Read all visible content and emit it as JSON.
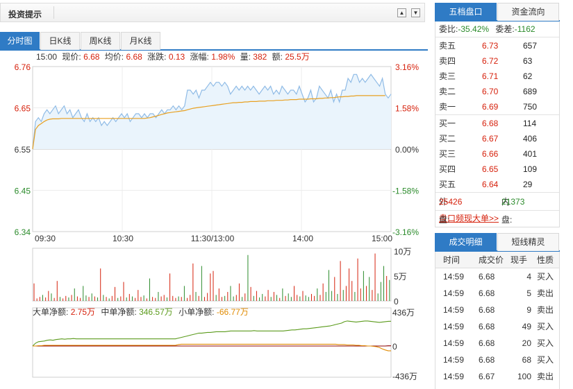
{
  "header": {
    "title": "投资提示",
    "up_icon": "▲",
    "down_icon": "▼"
  },
  "tabs": [
    "分时图",
    "日K线",
    "周K线",
    "月K线"
  ],
  "info": {
    "time": "15:00",
    "price_label": "现价:",
    "price": "6.68",
    "avg_label": "均价:",
    "avg": "6.68",
    "change_label": "涨跌:",
    "change": "0.13",
    "pct_label": "涨幅:",
    "pct": "1.98%",
    "vol_label": "量:",
    "vol": "382",
    "amt_label": "额:",
    "amt": "25.5万"
  },
  "chart_data": [
    {
      "type": "line",
      "x_ticks": [
        "09:30",
        "10:30",
        "11:30/13:00",
        "14:00",
        "15:00"
      ],
      "y_ticks_left": [
        "6.76",
        "6.65",
        "6.55",
        "6.45",
        "6.34"
      ],
      "y_ticks_right": [
        "3.16%",
        "1.58%",
        "0.00%",
        "-1.58%",
        "-3.16%"
      ],
      "ylim": [
        6.34,
        6.76
      ],
      "prev_close": 6.55,
      "series": [
        {
          "values": [
            6.55,
            6.62,
            6.63,
            6.62,
            6.64,
            6.65,
            6.64,
            6.65,
            6.66,
            6.64,
            6.65,
            6.66,
            6.64,
            6.65,
            6.63,
            6.64,
            6.65,
            6.63,
            6.62,
            6.64,
            6.62,
            6.63,
            6.62,
            6.63,
            6.61,
            6.62,
            6.61,
            6.62,
            6.63,
            6.62,
            6.63,
            6.64,
            6.63,
            6.64,
            6.62,
            6.63,
            6.64,
            6.64,
            6.63,
            6.64,
            6.63,
            6.64,
            6.64,
            6.63,
            6.64,
            6.65,
            6.64,
            6.65,
            6.65,
            6.66,
            6.65,
            6.66,
            6.65,
            6.66,
            6.7,
            6.7,
            6.69,
            6.7,
            6.68,
            6.7,
            6.7,
            6.71,
            6.72,
            6.71,
            6.72,
            6.72,
            6.71,
            6.72,
            6.71,
            6.69,
            6.7,
            6.71,
            6.7,
            6.71,
            6.7,
            6.71,
            6.7,
            6.71,
            6.7,
            6.69,
            6.7,
            6.71,
            6.7,
            6.71,
            6.69,
            6.7,
            6.69,
            6.71,
            6.7,
            6.69,
            6.7,
            6.7,
            6.69,
            6.71,
            6.69,
            6.67,
            6.68,
            6.7,
            6.67,
            6.68,
            6.71,
            6.7,
            6.69,
            6.68,
            6.7,
            6.67,
            6.69,
            6.67,
            6.7,
            6.7,
            6.73,
            6.72,
            6.74,
            6.74,
            6.72,
            6.73,
            6.72,
            6.73,
            6.74,
            6.73,
            6.72,
            6.71,
            6.73,
            6.69,
            6.68,
            6.69
          ]
        },
        {
          "values": [
            6.55,
            6.6,
            6.61,
            6.615,
            6.62,
            6.624,
            6.626,
            6.627,
            6.627,
            6.627,
            6.628,
            6.628,
            6.628,
            6.628,
            6.628,
            6.628,
            6.628,
            6.628,
            6.628,
            6.628,
            6.628,
            6.628,
            6.628,
            6.628,
            6.628,
            6.628,
            6.628,
            6.628,
            6.628,
            6.628,
            6.628,
            6.628,
            6.628,
            6.628,
            6.628,
            6.628,
            6.628,
            6.628,
            6.628,
            6.628,
            6.629,
            6.63,
            6.632,
            6.634,
            6.636,
            6.638,
            6.64,
            6.642,
            6.643,
            6.644,
            6.645,
            6.646,
            6.647,
            6.648,
            6.65,
            6.652,
            6.654,
            6.655,
            6.656,
            6.657,
            6.658,
            6.659,
            6.66,
            6.661,
            6.662,
            6.663,
            6.664,
            6.665,
            6.666,
            6.667,
            6.668,
            6.668,
            6.669,
            6.669,
            6.67,
            6.67,
            6.671,
            6.671,
            6.671,
            6.672,
            6.672,
            6.672,
            6.673,
            6.673,
            6.673,
            6.674,
            6.674,
            6.674,
            6.675,
            6.675,
            6.676,
            6.676,
            6.676,
            6.677,
            6.677,
            6.677,
            6.677,
            6.678,
            6.678,
            6.678,
            6.679,
            6.679,
            6.68,
            6.68,
            6.681,
            6.681,
            6.682,
            6.683,
            6.683,
            6.684,
            6.684,
            6.685,
            6.685,
            6.686,
            6.686,
            6.686,
            6.686,
            6.686,
            6.686,
            6.686,
            6.686,
            6.686,
            6.686,
            6.686
          ]
        }
      ]
    },
    {
      "type": "bar",
      "y_ticks": [
        "10万",
        "5万",
        "0"
      ],
      "ylim": [
        0,
        100000
      ],
      "values": [
        35000,
        5000,
        8000,
        12000,
        7000,
        20000,
        15000,
        6000,
        40000,
        8000,
        5000,
        10000,
        7000,
        12000,
        25000,
        9000,
        6000,
        30000,
        11000,
        8000,
        15000,
        9000,
        7000,
        65000,
        12000,
        8000,
        5000,
        10000,
        28000,
        6000,
        9000,
        38000,
        7000,
        14000,
        9000,
        6000,
        22000,
        8000,
        11000,
        5000,
        45000,
        8000,
        6000,
        18000,
        9000,
        12000,
        7000,
        55000,
        10000,
        6000,
        9000,
        8000,
        30000,
        6000,
        12000,
        75000,
        18000,
        10000,
        70000,
        8000,
        16000,
        55000,
        60000,
        12000,
        25000,
        8000,
        10000,
        18000,
        30000,
        9000,
        12000,
        35000,
        8000,
        15000,
        92000,
        28000,
        10000,
        20000,
        7000,
        14000,
        9000,
        22000,
        8000,
        18000,
        12000,
        6000,
        25000,
        10000,
        15000,
        8000,
        30000,
        12000,
        9000,
        20000,
        11000,
        8000,
        14000,
        10000,
        25000,
        12000,
        35000,
        18000,
        62000,
        20000,
        48000,
        14000,
        80000,
        22000,
        30000,
        65000,
        40000,
        18000,
        85000,
        25000,
        60000,
        30000,
        48000,
        22000,
        95000,
        15000,
        38000,
        70000,
        50000,
        42000
      ],
      "colors": [
        "#d6210c",
        "#2a8a2a"
      ]
    },
    {
      "type": "line",
      "y_ticks": [
        "436万",
        "0",
        "-436万"
      ],
      "ylim": [
        -436,
        436
      ],
      "legend": [
        {
          "name": "大单净额:",
          "value": "2.75万",
          "color": "#8b0000"
        },
        {
          "name": "中单净额:",
          "value": "346.57万",
          "color": "#5a9a1a"
        },
        {
          "name": "小单净额:",
          "value": "-66.77万",
          "color": "#e08a00"
        }
      ],
      "series": [
        {
          "name": "大单净额",
          "values": [
            0,
            0,
            0,
            0,
            0,
            0,
            0,
            0,
            0,
            0,
            0,
            0,
            0,
            0,
            0,
            0,
            0,
            0,
            0,
            0,
            0,
            0,
            0,
            0,
            0,
            0,
            0,
            0,
            0,
            0,
            0,
            0,
            0,
            0,
            0,
            0,
            0,
            0,
            0,
            0,
            0,
            0,
            0,
            0,
            0,
            0,
            0,
            0,
            0,
            0,
            0,
            0,
            0,
            0,
            0,
            0,
            0,
            0,
            0,
            0,
            0,
            0,
            0,
            0,
            0,
            0,
            0,
            0,
            0,
            0,
            0,
            0,
            0,
            0,
            0,
            0,
            0,
            0,
            0,
            0,
            0,
            0,
            0,
            0,
            0,
            0,
            0,
            0,
            0,
            0,
            0,
            0,
            0,
            0,
            0,
            0,
            0,
            0,
            0,
            0,
            0,
            0,
            0,
            0,
            0,
            0,
            0,
            0,
            0,
            0,
            0,
            0,
            0,
            0,
            0,
            0,
            0,
            0,
            0,
            0,
            0,
            0,
            3,
            3
          ]
        },
        {
          "name": "中单净额",
          "values": [
            0,
            40,
            60,
            65,
            70,
            80,
            85,
            80,
            90,
            95,
            100,
            95,
            100,
            100,
            105,
            100,
            100,
            100,
            100,
            100,
            100,
            100,
            100,
            100,
            100,
            100,
            100,
            100,
            100,
            100,
            100,
            100,
            100,
            100,
            100,
            100,
            100,
            100,
            100,
            100,
            100,
            100,
            100,
            100,
            100,
            100,
            100,
            100,
            100,
            100,
            110,
            120,
            130,
            140,
            150,
            160,
            170,
            180,
            180,
            185,
            190,
            190,
            195,
            200,
            200,
            200,
            200,
            205,
            210,
            210,
            210,
            210,
            210,
            210,
            210,
            210,
            215,
            210,
            210,
            210,
            210,
            210,
            210,
            210,
            210,
            210,
            210,
            215,
            220,
            225,
            225,
            230,
            235,
            240,
            240,
            245,
            250,
            255,
            260,
            265,
            270,
            275,
            280,
            290,
            300,
            310,
            320,
            340,
            350,
            345,
            340,
            335,
            340,
            345,
            350,
            350,
            345,
            340,
            335,
            330,
            335,
            340,
            345,
            346
          ]
        },
        {
          "name": "小单净额",
          "values": [
            0,
            0,
            5,
            5,
            10,
            10,
            10,
            10,
            10,
            10,
            10,
            10,
            10,
            10,
            10,
            10,
            10,
            10,
            10,
            10,
            10,
            10,
            10,
            10,
            10,
            10,
            10,
            10,
            10,
            10,
            10,
            10,
            10,
            10,
            10,
            10,
            10,
            10,
            10,
            10,
            10,
            10,
            10,
            10,
            10,
            10,
            10,
            10,
            10,
            10,
            20,
            25,
            25,
            25,
            25,
            25,
            25,
            25,
            25,
            25,
            25,
            25,
            25,
            25,
            25,
            25,
            25,
            25,
            25,
            25,
            25,
            25,
            25,
            25,
            25,
            25,
            25,
            25,
            25,
            25,
            25,
            25,
            25,
            25,
            25,
            25,
            25,
            25,
            25,
            25,
            25,
            25,
            25,
            25,
            25,
            25,
            25,
            25,
            25,
            25,
            25,
            25,
            25,
            25,
            25,
            20,
            20,
            20,
            15,
            15,
            15,
            10,
            10,
            5,
            5,
            0,
            0,
            -5,
            -10,
            -20,
            -40,
            -55,
            -67,
            -67
          ]
        }
      ]
    }
  ],
  "orderbook": {
    "tabs": [
      "五档盘口",
      "资金流向"
    ],
    "wb_label": "委比:",
    "wb": "-35.42%",
    "wc_label": "委差:",
    "wc": "-1162",
    "sell": [
      {
        "label": "卖五",
        "price": "6.73",
        "vol": "657"
      },
      {
        "label": "卖四",
        "price": "6.72",
        "vol": "63"
      },
      {
        "label": "卖三",
        "price": "6.71",
        "vol": "62"
      },
      {
        "label": "卖二",
        "price": "6.70",
        "vol": "689"
      },
      {
        "label": "卖一",
        "price": "6.69",
        "vol": "750"
      }
    ],
    "buy": [
      {
        "label": "买一",
        "price": "6.68",
        "vol": "114"
      },
      {
        "label": "买二",
        "price": "6.67",
        "vol": "406"
      },
      {
        "label": "买三",
        "price": "6.66",
        "vol": "401"
      },
      {
        "label": "买四",
        "price": "6.65",
        "vol": "109"
      },
      {
        "label": "买五",
        "price": "6.64",
        "vol": "29"
      }
    ],
    "out_label": "外盘:",
    "out": "25426",
    "in_label": "内盘:",
    "in": "21373",
    "big_order_link": "盘口频现大单>>"
  },
  "trades": {
    "tabs": [
      "成交明细",
      "短线精灵"
    ],
    "headers": [
      "时间",
      "成交价",
      "现手",
      "性质"
    ],
    "rows": [
      {
        "time": "14:59",
        "price": "6.68",
        "hand": "4",
        "type": "买入"
      },
      {
        "time": "14:59",
        "price": "6.68",
        "hand": "5",
        "type": "卖出"
      },
      {
        "time": "14:59",
        "price": "6.68",
        "hand": "9",
        "type": "卖出"
      },
      {
        "time": "14:59",
        "price": "6.68",
        "hand": "49",
        "type": "买入"
      },
      {
        "time": "14:59",
        "price": "6.68",
        "hand": "20",
        "type": "买入"
      },
      {
        "time": "14:59",
        "price": "6.68",
        "hand": "68",
        "type": "买入"
      },
      {
        "time": "14:59",
        "price": "6.67",
        "hand": "100",
        "type": "卖出"
      }
    ]
  },
  "colors": {
    "up": "#d6210c",
    "down": "#2a8a2a",
    "accent": "#2f7bc5",
    "price_line": "#8fbbe6",
    "avg_line": "#e8a020"
  }
}
